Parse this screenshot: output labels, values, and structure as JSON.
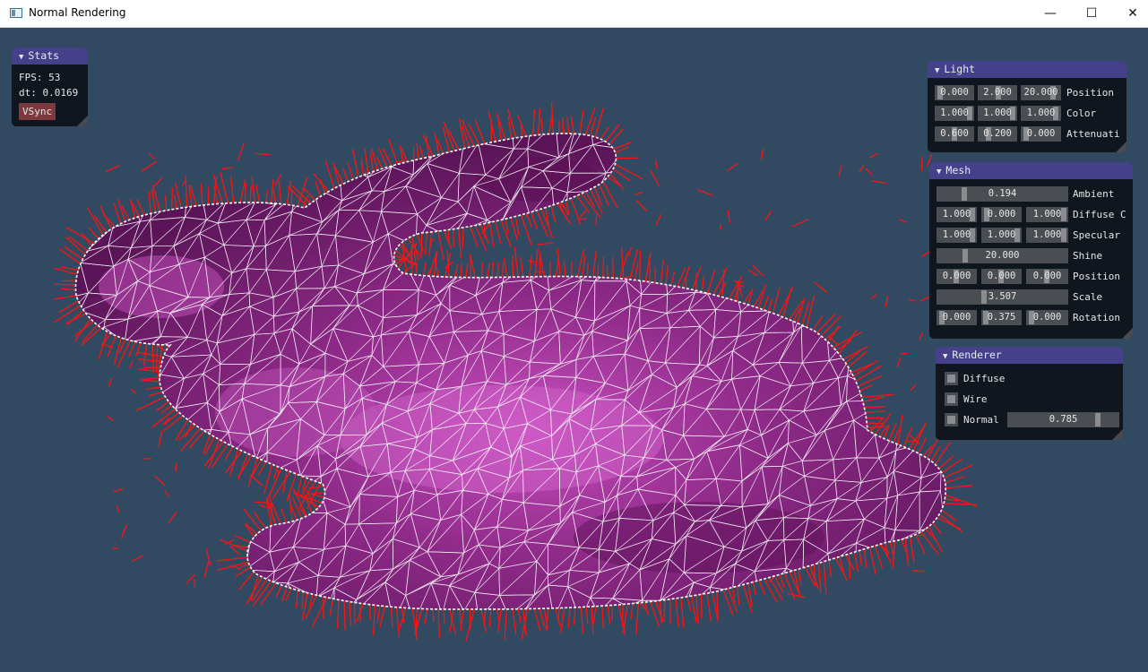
{
  "window": {
    "title": "Normal Rendering",
    "minimize_glyph": "—",
    "maximize_glyph": "☐",
    "close_glyph": "✕"
  },
  "colors": {
    "background": "#314a62",
    "mesh_fill": "#7a1f78",
    "wire": "#ffffff",
    "normals": "#ff1010",
    "panel_title": "#44418a"
  },
  "stats": {
    "title": "Stats",
    "fps": "FPS: 53",
    "dt": "dt: 0.0169",
    "vsync_label": "VSync"
  },
  "light": {
    "title": "Light",
    "rows": [
      {
        "label": "Position",
        "values": [
          "0.000",
          "2.000",
          "20.000"
        ]
      },
      {
        "label": "Color",
        "values": [
          "1.000",
          "1.000",
          "1.000"
        ]
      },
      {
        "label": "Attenuati",
        "values": [
          "0.600",
          "0.200",
          "0.000"
        ]
      }
    ]
  },
  "mesh": {
    "title": "Mesh",
    "ambient": {
      "label": "Ambient",
      "value": "0.194"
    },
    "diffuse": {
      "label": "Diffuse C",
      "values": [
        "1.000",
        "0.000",
        "1.000"
      ]
    },
    "specular": {
      "label": "Specular",
      "values": [
        "1.000",
        "1.000",
        "1.000"
      ]
    },
    "shine": {
      "label": "Shine",
      "value": "20.000"
    },
    "position": {
      "label": "Position",
      "values": [
        "0.000",
        "0.000",
        "0.000"
      ]
    },
    "scale": {
      "label": "Scale",
      "value": "3.507"
    },
    "rotation": {
      "label": "Rotation",
      "values": [
        "0.000",
        "0.375",
        "0.000"
      ]
    }
  },
  "renderer": {
    "title": "Renderer",
    "diffuse_label": "Diffuse",
    "wire_label": "Wire",
    "normal_label": "Normal",
    "normal_length": "0.785"
  }
}
